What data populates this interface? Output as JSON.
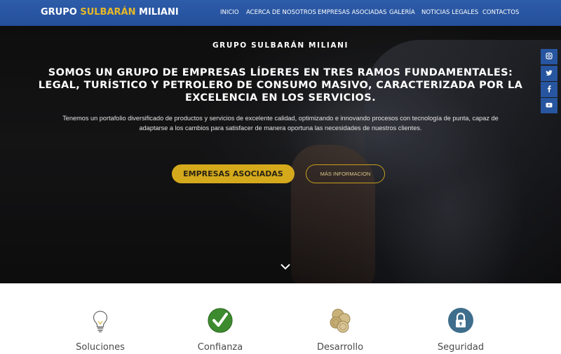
{
  "navbar": {
    "brand_part1": "GRUPO",
    "brand_part2": "SULBARÁN",
    "brand_part3": "MILIANI",
    "menu": [
      {
        "label": "INICIO"
      },
      {
        "label": "ACERCA DE NOSOTROS"
      },
      {
        "label": "EMPRESAS ASOCIADAS"
      },
      {
        "label": "GALERÍA"
      },
      {
        "label": "NOTICIAS LEGALES"
      },
      {
        "label": "CONTACTOS"
      }
    ]
  },
  "hero": {
    "kicker": "GRUPO SULBARÁN MILIANI",
    "title_line1": "SOMOS UN GRUPO DE EMPRESAS LÍDERES EN TRES RAMOS FUNDAMENTALES:",
    "title_line2": "LEGAL, TURÍSTICO Y PETROLERO DE CONSUMO MASIVO, CARACTERIZADA POR LA",
    "title_line3": "EXCELENCIA EN LOS SERVICIOS.",
    "desc_line1": "Tenemos un portafolio diversificado de productos y servicios de excelente calidad, optimizando e innovando procesos con tecnología de punta, capaz de",
    "desc_line2": "adaptarse a los cambios para satisfacer de manera oportuna las necesidades de nuestros clientes.",
    "primary_button": "EMPRESAS ASOCIADAS",
    "secondary_button": "MÁS INFORMACION"
  },
  "social": [
    {
      "icon": "instagram-icon",
      "glyph": "◙"
    },
    {
      "icon": "twitter-icon",
      "glyph": "✦"
    },
    {
      "icon": "facebook-icon",
      "glyph": "f"
    },
    {
      "icon": "youtube-icon",
      "glyph": "▶"
    }
  ],
  "features": [
    {
      "label": "Soluciones",
      "icon": "lightbulb-icon"
    },
    {
      "label": "Confianza",
      "icon": "checkmark-icon"
    },
    {
      "label": "Desarrollo",
      "icon": "coins-icon"
    },
    {
      "label": "Seguridad",
      "icon": "lock-icon"
    }
  ],
  "colors": {
    "navbar": "#2d5ca9",
    "accent_gold": "#d4a91c",
    "social_bg": "#27559f",
    "check_green": "#3d8b2f",
    "lock_blue": "#3f6e8c"
  }
}
